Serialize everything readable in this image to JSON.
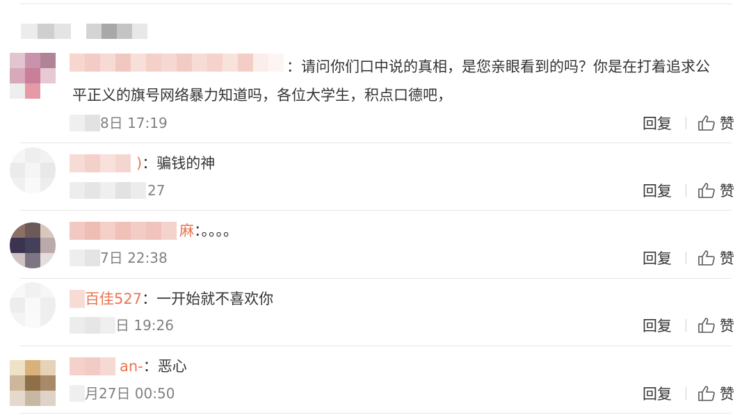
{
  "comments": [
    {
      "name_tail": "",
      "text_line1": "：请问你们口中说的真相，是您亲眼看到的吗？你是在打着追求公",
      "text_line2": "平正义的旗号网络暴力知道吗，各位大学生，积点口德吧，",
      "time_tail": "8日 17:19",
      "reply_label": "回复",
      "like_label": "赞"
    },
    {
      "name_tail": ")",
      "text_line1": "：骗钱的神",
      "time_tail": "27",
      "reply_label": "回复",
      "like_label": "赞"
    },
    {
      "name_tail": "麻",
      "text_line1": "：。。。。",
      "time_tail": "7日 22:38",
      "reply_label": "回复",
      "like_label": "赞"
    },
    {
      "name_tail": "百佳527",
      "text_line1": "：一开始就不喜欢你",
      "time_tail": "日 19:26",
      "reply_label": "回复",
      "like_label": "赞"
    },
    {
      "name_tail": "an-",
      "text_line1": "：恶心",
      "time_tail": "月27日 00:50",
      "reply_label": "回复",
      "like_label": "赞"
    }
  ],
  "colors": {
    "username": "#eb7350",
    "text": "#333333",
    "timestamp": "#808080",
    "divider": "#e6e6e6"
  },
  "icons": {
    "like": "thumbs-up-icon"
  }
}
